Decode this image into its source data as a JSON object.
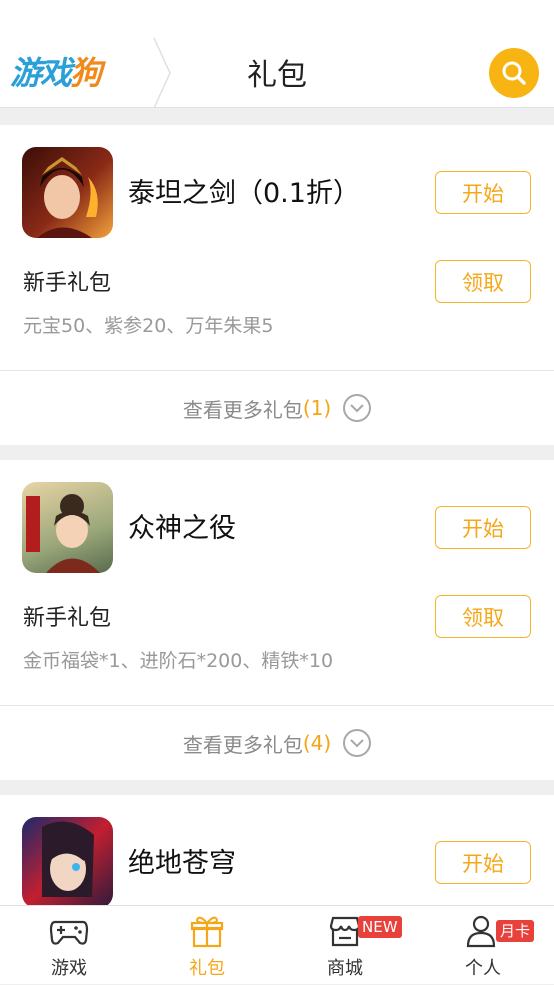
{
  "header": {
    "logo_text_a": "游戏",
    "logo_text_b": "狗",
    "title": "礼包",
    "search_icon": "search-icon"
  },
  "games": [
    {
      "name": "泰坦之剑（0.1折）",
      "start_label": "开始",
      "pack_title": "新手礼包",
      "pack_desc": "元宝50、紫参20、万年朱果5",
      "claim_label": "领取",
      "more_label": "查看更多礼包",
      "more_count": "(1)",
      "icon_colors": [
        "#7a1e12",
        "#e5572b"
      ]
    },
    {
      "name": "众神之役",
      "start_label": "开始",
      "pack_title": "新手礼包",
      "pack_desc": "金币福袋*1、进阶石*200、精铁*10",
      "claim_label": "领取",
      "more_label": "查看更多礼包",
      "more_count": "(4)",
      "icon_colors": [
        "#c9b07a",
        "#6e8b5d"
      ]
    },
    {
      "name": "绝地苍穹",
      "start_label": "开始",
      "icon_colors": [
        "#c71c2a",
        "#1e2f6e"
      ]
    }
  ],
  "tabbar": {
    "items": [
      {
        "label": "游戏",
        "icon": "gamepad-icon"
      },
      {
        "label": "礼包",
        "icon": "gift-icon",
        "active": true
      },
      {
        "label": "商城",
        "icon": "store-icon",
        "badge": "NEW"
      },
      {
        "label": "个人",
        "icon": "person-icon",
        "badge": "月卡"
      }
    ]
  },
  "colors": {
    "accent": "#f6a718",
    "badge": "#e8403a",
    "logo_blue": "#2a9fd8"
  }
}
